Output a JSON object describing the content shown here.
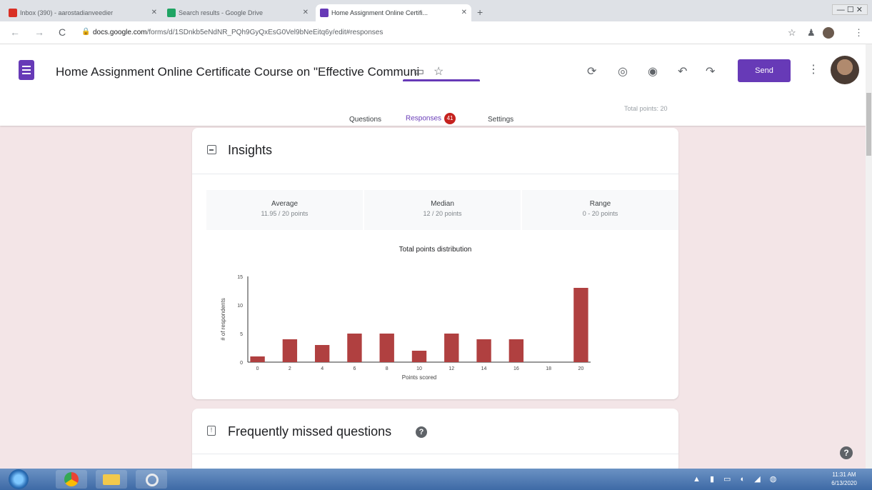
{
  "browser": {
    "tabs": [
      {
        "label": "Inbox (390) - aarostadianveedier"
      },
      {
        "label": "Search results - Google Drive"
      },
      {
        "label": "Home Assignment Online Certifi..."
      }
    ],
    "new_tab": "+",
    "url_prefix": "docs.google.com",
    "url_rest": "/forms/d/1SDnkb5eNdNR_PQh9GyQxEsG0Vel9bNeEitq6y/edit#responses",
    "nav": {
      "back": "←",
      "forward": "→",
      "reload": "C"
    }
  },
  "form": {
    "title": "Home Assignment Online Certificate Course on \"Effective Communi",
    "send_label": "Send",
    "tabs": {
      "questions": "Questions",
      "responses": "Responses",
      "responses_count": "41",
      "settings": "Settings"
    },
    "total_points": "Total points: 20"
  },
  "insights": {
    "title": "Insights",
    "stats": [
      {
        "label": "Average",
        "value": "11.95 / 20 points"
      },
      {
        "label": "Median",
        "value": "12 / 20 points"
      },
      {
        "label": "Range",
        "value": "0 - 20 points"
      }
    ],
    "chart_title": "Total points distribution"
  },
  "chart_data": {
    "type": "bar",
    "title": "Total points distribution",
    "xlabel": "Points scored",
    "ylabel": "# of respondents",
    "x": [
      0,
      1,
      2,
      3,
      4,
      5,
      6,
      7,
      8,
      9,
      10,
      11,
      12,
      13,
      14,
      15,
      16,
      17,
      18,
      19,
      20
    ],
    "values": [
      1,
      0,
      4,
      0,
      3,
      0,
      5,
      0,
      5,
      0,
      2,
      0,
      5,
      0,
      4,
      0,
      4,
      0,
      0,
      0,
      13
    ],
    "x_ticks": [
      "0",
      "2",
      "4",
      "6",
      "8",
      "10",
      "12",
      "14",
      "16",
      "18",
      "20"
    ],
    "y_ticks": [
      "0",
      "5",
      "10",
      "15"
    ],
    "ylim": [
      0,
      15
    ],
    "bar_color": "#b04040"
  },
  "missed": {
    "title": "Frequently missed questions",
    "help": "?"
  },
  "taskbar": {
    "clock_time": "11:31 AM",
    "clock_date": "6/13/2020"
  },
  "colors": {
    "accent": "#673ab7",
    "background": "#f3e5e7",
    "badge": "#c5221f"
  }
}
